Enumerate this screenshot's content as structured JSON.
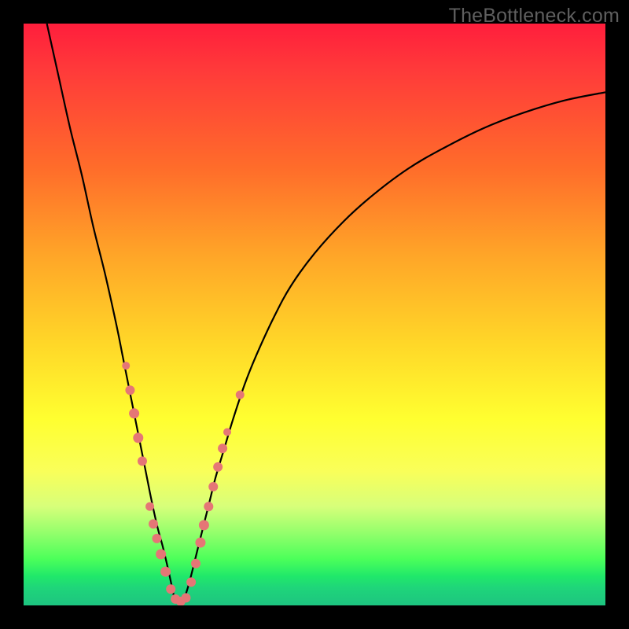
{
  "watermark": "TheBottleneck.com",
  "chart_data": {
    "type": "line",
    "title": "",
    "xlabel": "",
    "ylabel": "",
    "xlim": [
      0,
      100
    ],
    "ylim": [
      0,
      100
    ],
    "grid": false,
    "legend": false,
    "background_gradient": [
      "#ff1e3c",
      "#ffff30",
      "#1dc480"
    ],
    "series": [
      {
        "name": "left-curve",
        "x": [
          4,
          6,
          8,
          10,
          12,
          14,
          16,
          17,
          18,
          19,
          20,
          21,
          22,
          23,
          24,
          25,
          26
        ],
        "y": [
          100,
          91,
          82,
          74,
          65,
          57,
          48,
          43,
          38,
          33,
          28,
          23,
          18,
          13.5,
          9.8,
          5.5,
          0.8
        ]
      },
      {
        "name": "right-curve",
        "x": [
          27.5,
          28.5,
          30,
          31,
          32,
          33,
          34.5,
          36,
          38,
          40,
          43,
          46,
          50,
          55,
          60,
          66,
          72,
          79,
          86,
          93,
          100
        ],
        "y": [
          0.8,
          4,
          10,
          14,
          18,
          22,
          27,
          32,
          38,
          43,
          49.5,
          55,
          60.5,
          66,
          70.5,
          75,
          78.5,
          82,
          84.7,
          86.8,
          88.2
        ]
      }
    ],
    "markers": [
      {
        "x": 17.6,
        "y": 41.2,
        "r": 5
      },
      {
        "x": 18.3,
        "y": 37.0,
        "r": 6
      },
      {
        "x": 19.0,
        "y": 33.0,
        "r": 6.5
      },
      {
        "x": 19.7,
        "y": 28.8,
        "r": 6.5
      },
      {
        "x": 20.4,
        "y": 24.8,
        "r": 6
      },
      {
        "x": 21.7,
        "y": 17.0,
        "r": 5.5
      },
      {
        "x": 22.3,
        "y": 14.0,
        "r": 6
      },
      {
        "x": 22.9,
        "y": 11.5,
        "r": 6
      },
      {
        "x": 23.6,
        "y": 8.8,
        "r": 6.5
      },
      {
        "x": 24.4,
        "y": 5.8,
        "r": 6.5
      },
      {
        "x": 25.3,
        "y": 2.8,
        "r": 6
      },
      {
        "x": 26.1,
        "y": 1.1,
        "r": 6
      },
      {
        "x": 27.0,
        "y": 0.7,
        "r": 6
      },
      {
        "x": 27.9,
        "y": 1.3,
        "r": 6
      },
      {
        "x": 28.8,
        "y": 4.0,
        "r": 6
      },
      {
        "x": 29.6,
        "y": 7.2,
        "r": 6
      },
      {
        "x": 30.4,
        "y": 10.8,
        "r": 6.5
      },
      {
        "x": 31.0,
        "y": 13.8,
        "r": 6.5
      },
      {
        "x": 31.8,
        "y": 17.0,
        "r": 6
      },
      {
        "x": 32.6,
        "y": 20.4,
        "r": 6
      },
      {
        "x": 33.4,
        "y": 23.8,
        "r": 6
      },
      {
        "x": 34.2,
        "y": 27.0,
        "r": 6
      },
      {
        "x": 35.0,
        "y": 29.8,
        "r": 5
      },
      {
        "x": 37.2,
        "y": 36.2,
        "r": 5.5
      }
    ]
  }
}
